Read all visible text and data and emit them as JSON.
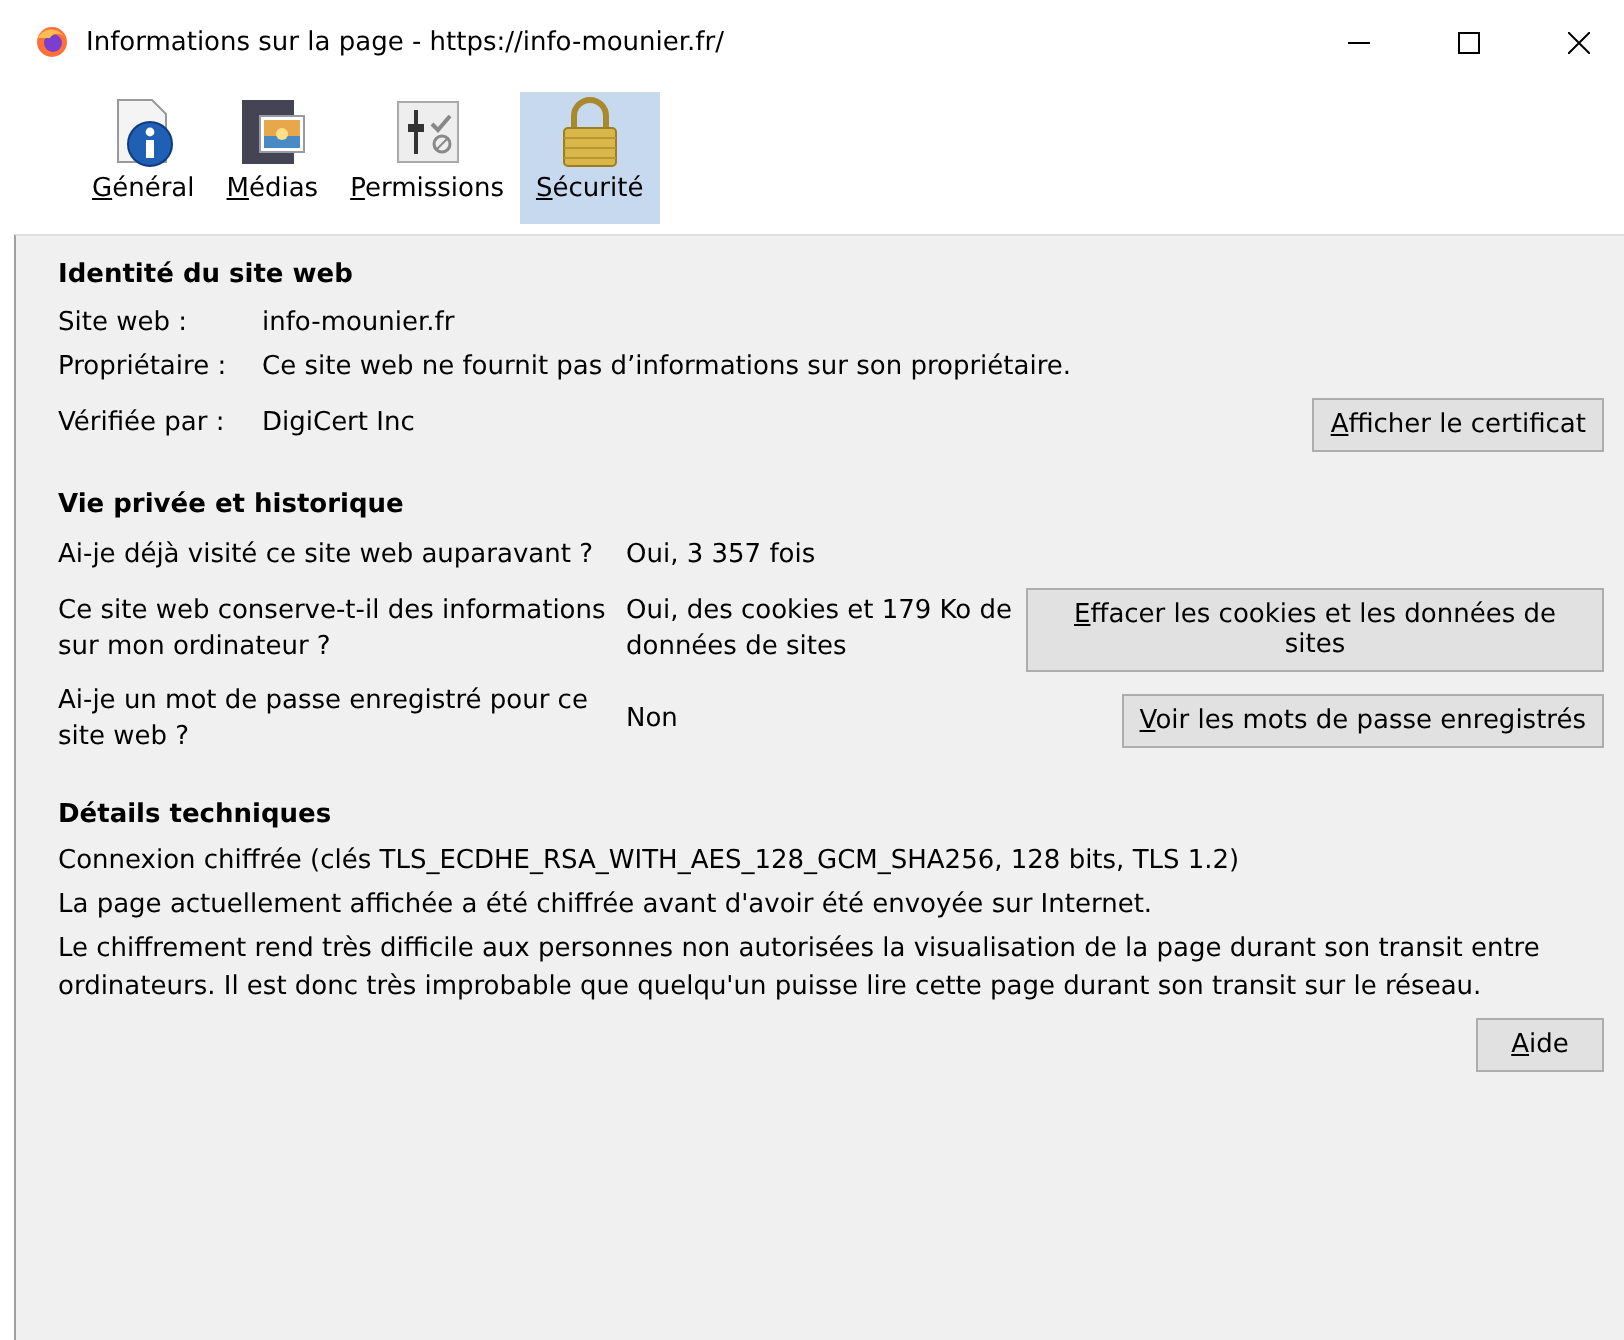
{
  "window": {
    "title": "Informations sur la page - https://info-mounier.fr/"
  },
  "tabs": [
    {
      "label": "Général",
      "kind": "info",
      "selected": false
    },
    {
      "label": "Médias",
      "kind": "media",
      "selected": false
    },
    {
      "label": "Permissions",
      "kind": "permissions",
      "selected": false
    },
    {
      "label": "Sécurité",
      "kind": "lock",
      "selected": true
    }
  ],
  "identity": {
    "heading": "Identité du site web",
    "rows": [
      {
        "label": "Site web :",
        "value": "info-mounier.fr"
      },
      {
        "label": "Propriétaire :",
        "value": "Ce site web ne fournit pas d’informations sur son propriétaire."
      },
      {
        "label": "Vérifiée par :",
        "value": "DigiCert Inc",
        "button": "Afficher le certificat"
      }
    ]
  },
  "privacy": {
    "heading": "Vie privée et historique",
    "rows": [
      {
        "question": "Ai-je déjà visité ce site web auparavant ?",
        "answer": "Oui, 3 357 fois"
      },
      {
        "question": "Ce site web conserve-t-il des informations sur mon ordinateur ?",
        "answer": "Oui, des cookies et 179 Ko de données de sites",
        "button": "Effacer les cookies et les données de sites"
      },
      {
        "question": "Ai-je un mot de passe enregistré pour ce site web ?",
        "answer": "Non",
        "button": "Voir les mots de passe enregistrés"
      }
    ]
  },
  "technical": {
    "heading": "Détails techniques",
    "lines": [
      "Connexion chiffrée (clés TLS_ECDHE_RSA_WITH_AES_128_GCM_SHA256, 128 bits, TLS 1.2)",
      "La page actuellement affichée a été chiffrée avant d'avoir été envoyée sur Internet.",
      "Le chiffrement rend très difficile aux personnes non autorisées la visualisation de la page durant son transit entre ordinateurs. Il est donc très improbable que quelqu'un puisse lire cette page durant son transit sur le réseau."
    ],
    "button": "Aide"
  }
}
